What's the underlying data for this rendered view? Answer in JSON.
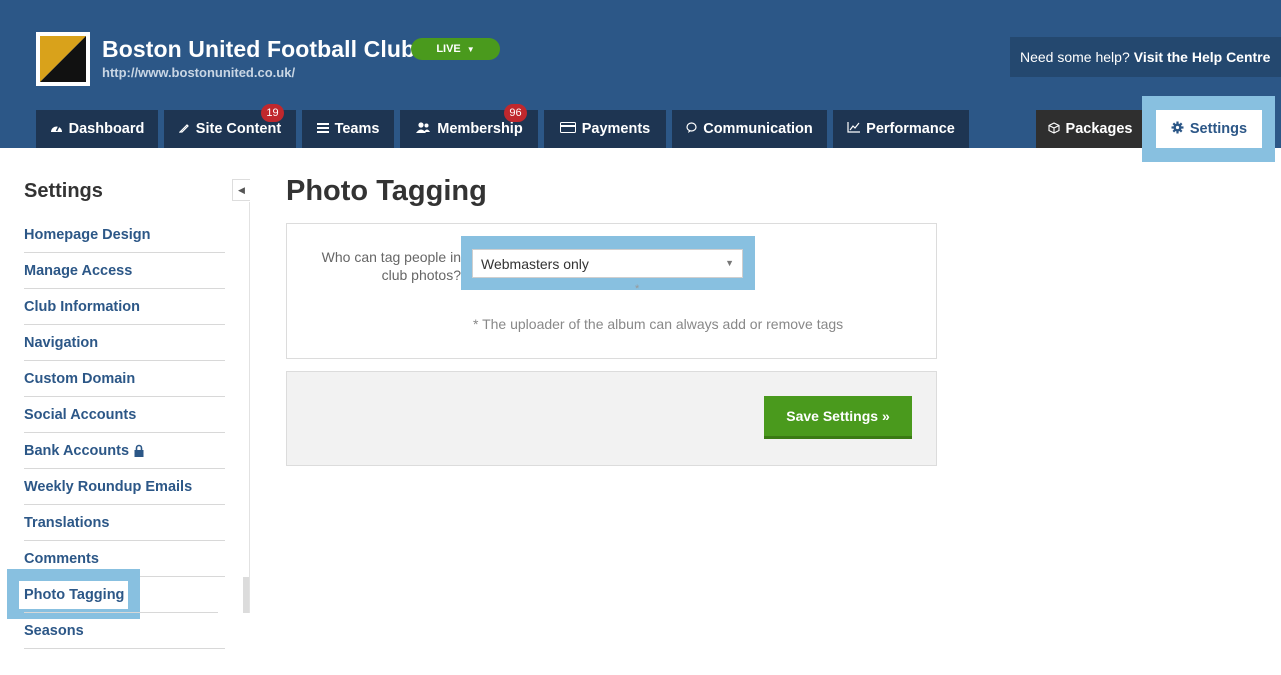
{
  "header": {
    "club_name": "Boston United Football Club",
    "club_url": "http://www.bostonunited.co.uk/",
    "live_label": "LIVE",
    "help_text": "Need some help?",
    "help_link": "Visit the Help Centre"
  },
  "nav": {
    "tabs": [
      {
        "label": "Dashboard",
        "icon": "dashboard-icon"
      },
      {
        "label": "Site Content",
        "icon": "pencil-icon",
        "badge": "19"
      },
      {
        "label": "Teams",
        "icon": "list-icon"
      },
      {
        "label": "Membership",
        "icon": "users-icon",
        "badge": "96"
      },
      {
        "label": "Payments",
        "icon": "card-icon"
      },
      {
        "label": "Communication",
        "icon": "speech-bubble-icon"
      },
      {
        "label": "Performance",
        "icon": "chart-icon"
      },
      {
        "label": "Packages",
        "icon": "cube-icon"
      },
      {
        "label": "Settings",
        "icon": "gear-icon",
        "active": true
      }
    ]
  },
  "sidebar": {
    "title": "Settings",
    "items": [
      {
        "label": "Homepage Design"
      },
      {
        "label": "Manage Access"
      },
      {
        "label": "Club Information"
      },
      {
        "label": "Navigation"
      },
      {
        "label": "Custom Domain"
      },
      {
        "label": "Social Accounts"
      },
      {
        "label": "Bank Accounts",
        "icon": "lock-icon"
      },
      {
        "label": "Weekly Roundup Emails"
      },
      {
        "label": "Translations"
      },
      {
        "label": "Comments"
      },
      {
        "label": "Photo Tagging",
        "active": true
      },
      {
        "label": "Seasons"
      }
    ]
  },
  "main": {
    "title": "Photo Tagging",
    "field_label": "Who can tag people in club photos?",
    "select_value": "Webmasters only",
    "required_mark": "*",
    "note": "* The uploader of the album can always add or remove tags",
    "save_label": "Save Settings »"
  },
  "colors": {
    "header_bg": "#2c5787",
    "nav_tab_bg": "#1e3552",
    "highlight": "#88c0e0",
    "green": "#4a9a1d",
    "badge_red": "#c0282d"
  }
}
